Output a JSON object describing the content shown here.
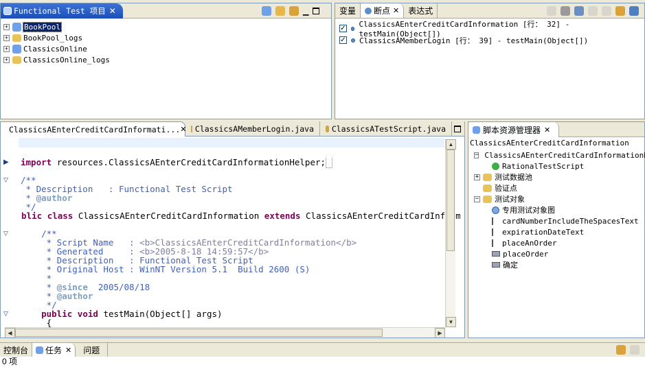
{
  "project": {
    "title": "Functional Test 项目",
    "items": [
      "BookPool",
      "BookPool_logs",
      "ClassicsOnline",
      "ClassicsOnline_logs"
    ]
  },
  "debug": {
    "tabs": [
      "变量",
      "断点",
      "表达式"
    ],
    "breakpoints": [
      "ClassicsAEnterCreditCardInformation [行： 32] - testMain(Object[])",
      "ClassicsAMemberLogin [行： 39] - testMain(Object[])"
    ]
  },
  "editor": {
    "tabs": [
      "ClassicsAEnterCreditCardInformati...",
      "ClassicsAMemberLogin.java",
      "ClassicsATestScript.java"
    ],
    "import_line": "resources.ClassicsAEnterCreditCardInformationHelper;",
    "code": {
      "doc_desc": " * Description   : Functional Test Script",
      "doc_author": "@author",
      "class_name": "ClassicsAEnterCreditCardInformation",
      "extends_name": "ClassicsAEnterCreditCardInformationHelper",
      "script_name_label": "     * Script Name   : ",
      "script_name_value": "<b>ClassicsAEnterCreditCardInformation</b>",
      "generated_label": "     * Generated     : ",
      "generated_value": "<b>2005-8-18 14:59:57</b>",
      "desc2": "     * Description   : Functional Test Script",
      "original_host": "     * Original Host : WinNT Version 5.1  Build 2600 (S)",
      "since_value": "  2005/08/18",
      "method_sig": "testMain(Object[] args)"
    }
  },
  "explorer": {
    "title": "脚本资源管理器",
    "root": "ClassicsAEnterCreditCardInformation",
    "items": [
      "ClassicsAEnterCreditCardInformationH",
      "RationalTestScript",
      "测试数据池",
      "验证点",
      "测试对象",
      "专用测试对象图",
      "cardNumberIncludeTheSpacesText",
      "expirationDateText",
      "placeAnOrder",
      "placeOrder",
      "确定"
    ]
  },
  "bottom": {
    "tabs": [
      "控制台",
      "任务",
      "问题"
    ],
    "status": "0 项"
  },
  "colors": {
    "accent": "#2456c6",
    "keyword": "#7f0055",
    "comment": "#3f5fbf"
  }
}
